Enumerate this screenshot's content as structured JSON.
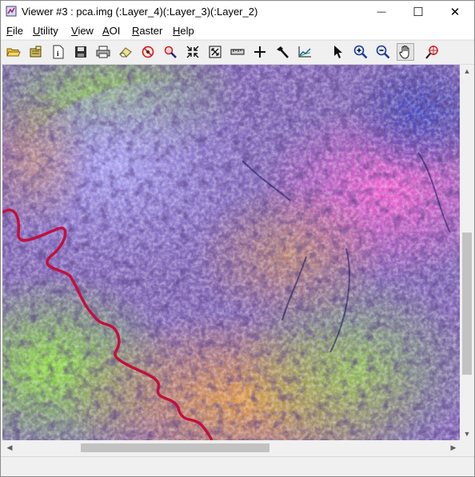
{
  "window": {
    "title": "Viewer #3 : pca.img (:Layer_4)(:Layer_3)(:Layer_2)",
    "minimize_glyph": "—",
    "maximize_glyph": "☐",
    "close_glyph": "✕"
  },
  "menu": [
    {
      "first": "F",
      "rest": "ile"
    },
    {
      "first": "U",
      "rest": "tility"
    },
    {
      "first": "V",
      "rest": "iew"
    },
    {
      "first": "A",
      "rest": "OI"
    },
    {
      "first": "R",
      "rest": "aster"
    },
    {
      "first": "H",
      "rest": "elp"
    }
  ],
  "toolbar": {
    "tools": [
      "open-file",
      "open-layer",
      "layer-info",
      "save",
      "print",
      "eraser",
      "clear-view",
      "inquire-cursor",
      "zoom-to-fit",
      "scale-to-window",
      "measure",
      "inquire-crosshair",
      "arrange-layers",
      "spectral-profile",
      "select",
      "zoom-in",
      "zoom-out",
      "pan",
      "interactive-zoom"
    ],
    "active_tool": "pan"
  },
  "image": {
    "name": "pca.img",
    "bands": [
      "Layer_4",
      "Layer_3",
      "Layer_2"
    ],
    "palette": {
      "lavender": "#9c8fe8",
      "magenta": "#e050c8",
      "green": "#7ed23c",
      "blue": "#3a3aa0",
      "orange": "#d98a3a",
      "river": "#c01040"
    }
  },
  "scrollbars": {
    "vertical_position": 0.62,
    "vertical_visible_fraction": 0.38,
    "horizontal_position": 0.19,
    "horizontal_visible_fraction": 0.45
  },
  "status": {
    "text": ""
  }
}
